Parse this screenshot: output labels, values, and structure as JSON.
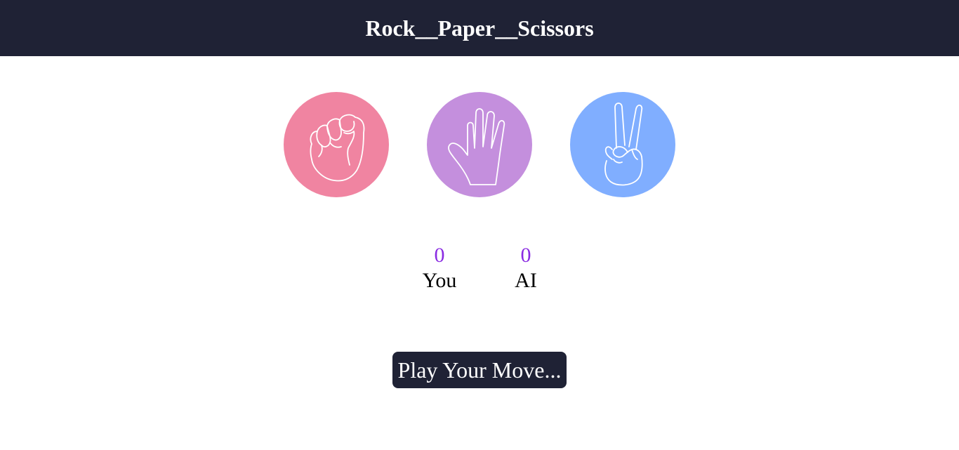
{
  "header": {
    "title": "Rock__Paper__Scissors",
    "background": "#1f2235"
  },
  "choices": [
    {
      "name": "rock",
      "icon": "fist-icon",
      "color": "#f084a1"
    },
    {
      "name": "paper",
      "icon": "open-hand-icon",
      "color": "#c48fdd"
    },
    {
      "name": "scissors",
      "icon": "peace-hand-icon",
      "color": "#80aeff"
    }
  ],
  "scoreboard": {
    "score_color": "#8a2be2",
    "you": {
      "score": "0",
      "label": "You"
    },
    "ai": {
      "score": "0",
      "label": "AI"
    }
  },
  "play_button": {
    "label": "Play Your Move...",
    "background": "#1f2235"
  }
}
